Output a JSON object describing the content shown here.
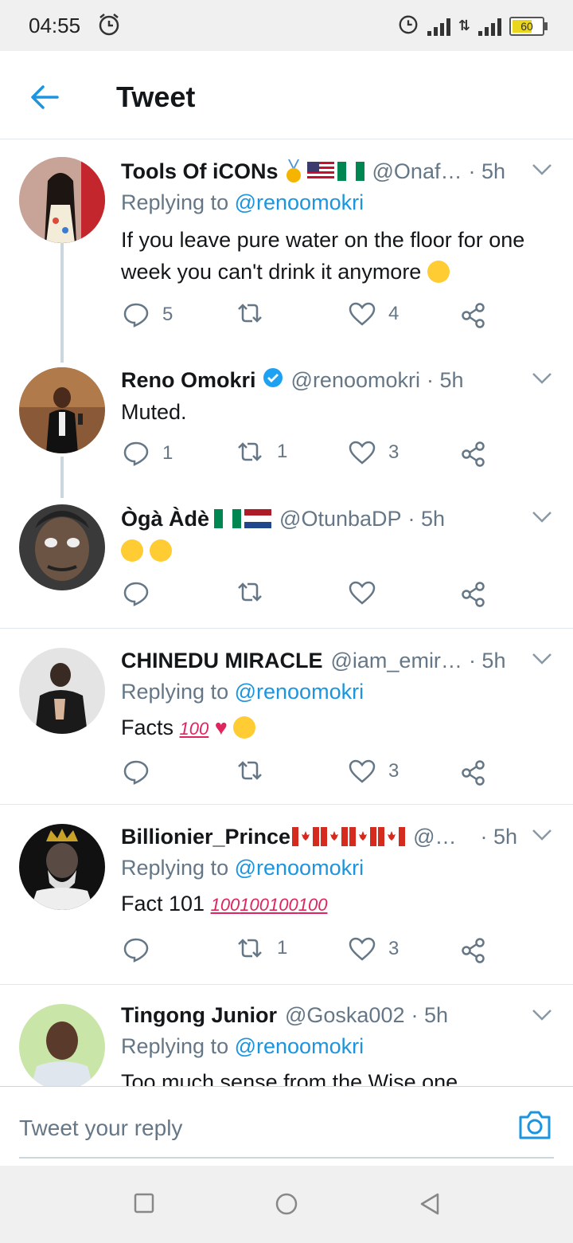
{
  "status_bar": {
    "time": "04:55",
    "battery": "60"
  },
  "app_bar": {
    "title": "Tweet"
  },
  "tweets": [
    {
      "name": "Tools Of iCONs",
      "handle": "@Onaf…",
      "time": "· 5h",
      "replying_prefix": "Replying to",
      "replying_to": "@renoomokri",
      "text": "If you leave pure water on the floor for one week you can't drink it anymore",
      "replies": "5",
      "retweets": "",
      "likes": "4"
    },
    {
      "name": "Reno Omokri",
      "handle": "@renoomokri",
      "time": "· 5h",
      "text": "Muted.",
      "replies": "1",
      "retweets": "1",
      "likes": "3"
    },
    {
      "name": "Ògà Àdè",
      "handle": "@OtunbaDP",
      "time": "· 5h",
      "text": "",
      "replies": "",
      "retweets": "",
      "likes": ""
    },
    {
      "name": "CHINEDU MIRACLE",
      "handle": "@iam_emir…",
      "time": "· 5h",
      "replying_prefix": "Replying to",
      "replying_to": "@renoomokri",
      "text": "Facts",
      "replies": "",
      "retweets": "",
      "likes": "3"
    },
    {
      "name": "Billionier_Prince",
      "handle": "@…",
      "time": "· 5h",
      "replying_prefix": "Replying to",
      "replying_to": "@renoomokri",
      "text": "Fact 101",
      "replies": "",
      "retweets": "1",
      "likes": "3"
    },
    {
      "name": "Tingong Junior",
      "handle": "@Goska002",
      "time": "· 5h",
      "replying_prefix": "Replying to",
      "replying_to": "@renoomokri",
      "text": "Too much sense from the Wise one"
    }
  ],
  "composer": {
    "placeholder": "Tweet your reply"
  },
  "colors": {
    "accent": "#1b95e0",
    "secondary_text": "#657786",
    "divider": "#e1e8ed"
  }
}
